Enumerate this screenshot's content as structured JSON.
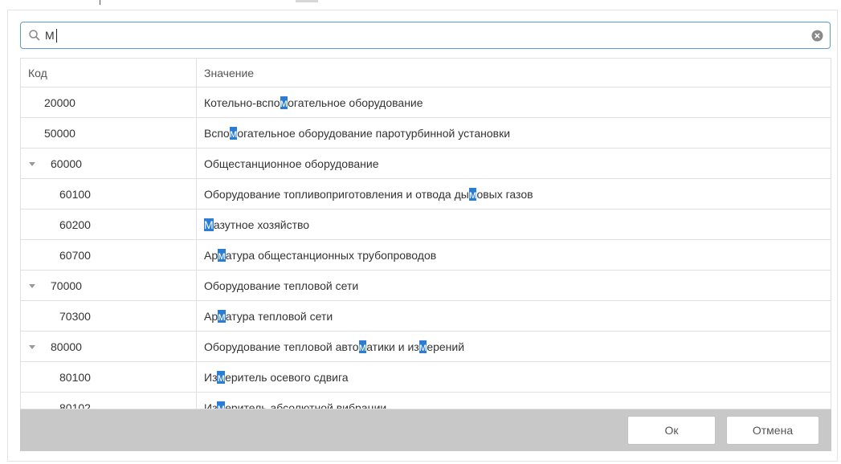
{
  "search": {
    "value": "М"
  },
  "grid": {
    "columns": {
      "code": "Код",
      "value": "Значение"
    },
    "rows": [
      {
        "code": "20000",
        "level": 0,
        "expandable": false,
        "value": "Котельно-вспомогательное оборудование"
      },
      {
        "code": "50000",
        "level": 0,
        "expandable": false,
        "value": "Вспомогательное оборудование паротурбинной установки"
      },
      {
        "code": "60000",
        "level": 0,
        "expandable": true,
        "value": "Общестанционное оборудование"
      },
      {
        "code": "60100",
        "level": 1,
        "expandable": false,
        "value": "Оборудование топливоприготовления и отвода дымовых газов"
      },
      {
        "code": "60200",
        "level": 1,
        "expandable": false,
        "value": "Мазутное хозяйство"
      },
      {
        "code": "60700",
        "level": 1,
        "expandable": false,
        "value": "Арматура общестанционных трубопроводов"
      },
      {
        "code": "70000",
        "level": 0,
        "expandable": true,
        "value": "Оборудование тепловой сети"
      },
      {
        "code": "70300",
        "level": 1,
        "expandable": false,
        "value": "Арматура тепловой сети"
      },
      {
        "code": "80000",
        "level": 0,
        "expandable": true,
        "value": "Оборудование тепловой автоматики и измерений"
      },
      {
        "code": "80100",
        "level": 1,
        "expandable": false,
        "value": "Измеритель осевого сдвига"
      },
      {
        "code": "80102",
        "level": 1,
        "expandable": false,
        "value": "Измеритель абсолютной вибрации"
      }
    ]
  },
  "buttons": {
    "ok": "Ок",
    "cancel": "Отмена"
  },
  "colors": {
    "highlight": "#2b7cd3",
    "focus_border": "#5a9bd5",
    "footer_bg": "#c8c8c8"
  }
}
